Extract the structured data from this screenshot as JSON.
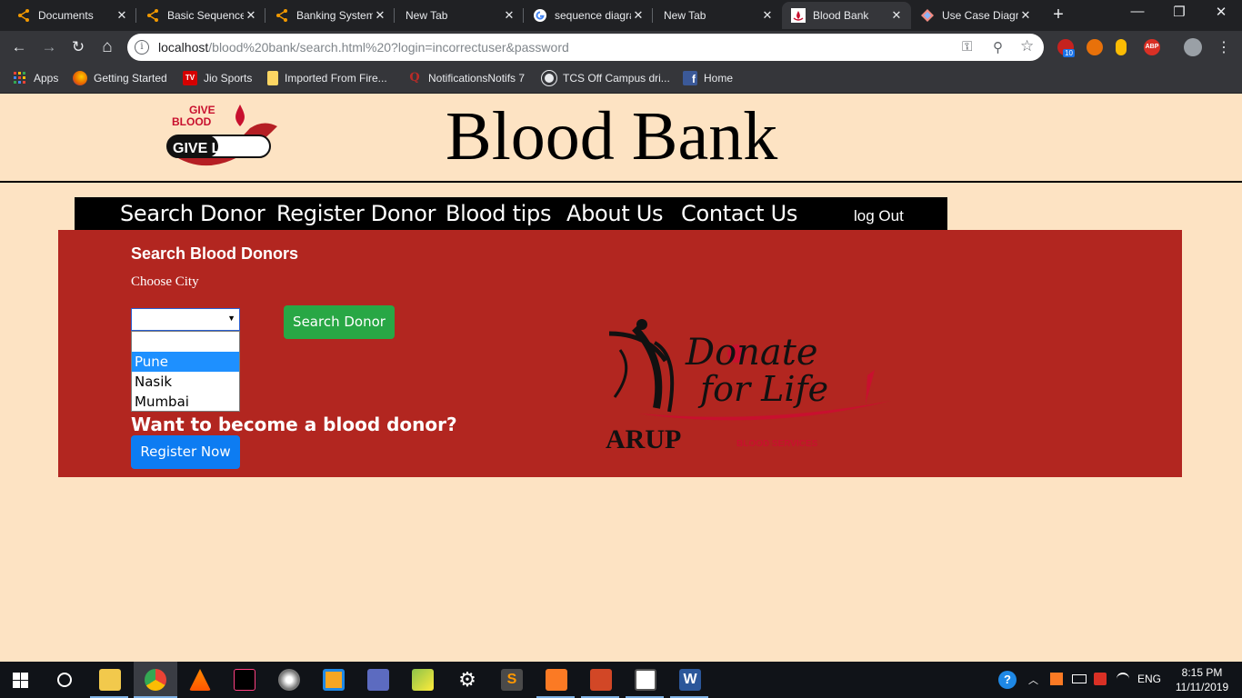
{
  "browser": {
    "tabs": [
      {
        "title": "Documents",
        "icon": "share-node-icon",
        "close": "✕"
      },
      {
        "title": "Basic Sequence",
        "icon": "share-node-icon",
        "close": "✕"
      },
      {
        "title": "Banking System",
        "icon": "share-node-icon",
        "close": "✕"
      },
      {
        "title": "New Tab",
        "icon": "",
        "close": "✕"
      },
      {
        "title": "sequence diagram",
        "icon": "google-icon",
        "close": "✕"
      },
      {
        "title": "New Tab",
        "icon": "",
        "close": "✕"
      },
      {
        "title": "Blood Bank",
        "icon": "blood-bank-favicon",
        "close": "✕",
        "active": true
      },
      {
        "title": "Use Case Diagram",
        "icon": "diagram-icon",
        "close": "✕"
      }
    ],
    "new_tab_label": "+",
    "window_controls": {
      "minimize": "—",
      "maximize": "❐",
      "close": "✕"
    },
    "nav": {
      "back": "←",
      "forward": "→",
      "reload": "↻",
      "home": "⌂"
    },
    "address": {
      "info": "i",
      "host": "localhost",
      "path": "/blood%20bank/search.html%20?login=incorrectuser&password"
    },
    "omnibox_icons": {
      "key": "⚿",
      "zoom": "⚲",
      "star": "☆"
    },
    "extensions": {
      "badge": "10",
      "abp": "ABP"
    },
    "bookmarks": [
      {
        "label": "Apps",
        "icon": "apps-grid-icon"
      },
      {
        "label": "Getting Started",
        "icon": "firefox-icon"
      },
      {
        "label": "Jio Sports",
        "icon": "tv-icon"
      },
      {
        "label": "Imported From Fire...",
        "icon": "folder-icon"
      },
      {
        "label": "NotificationsNotifs 7",
        "icon": "quora-icon"
      },
      {
        "label": "TCS Off Campus dri...",
        "icon": "globe-icon"
      },
      {
        "label": "Home",
        "icon": "facebook-icon"
      }
    ]
  },
  "site": {
    "logo": {
      "line1": "GIVE",
      "line2": "BLOOD",
      "line3": "GIVE LIFE"
    },
    "title": "Blood Bank",
    "nav": {
      "search": "Search Donor",
      "register": "Register Donor",
      "tips": "Blood tips",
      "about": "About Us",
      "contact": "Contact Us",
      "logout": "log Out"
    },
    "search": {
      "heading": "Search Blood Donors",
      "city_label": "Choose City",
      "selected_city": "",
      "options": [
        "",
        "Pune",
        "Nasik",
        "Mumbai"
      ],
      "highlighted_option": "Pune",
      "button": "Search Donor"
    },
    "cta": {
      "heading": "Want to become a blood donor?",
      "button": "Register Now"
    },
    "donate_logo": {
      "line1": "Donate",
      "line2": "for Life",
      "brand": "ARUP",
      "sub": "BLOOD SERVICES"
    }
  },
  "taskbar": {
    "tray_lang": "ENG",
    "time": "8:15 PM",
    "date": "11/11/2019"
  },
  "colors": {
    "page_bg": "#fde3c3",
    "panel": "#b22620",
    "search_button": "#28a745",
    "register_button": "#0d7cf2",
    "option_highlight": "#1e90ff"
  }
}
